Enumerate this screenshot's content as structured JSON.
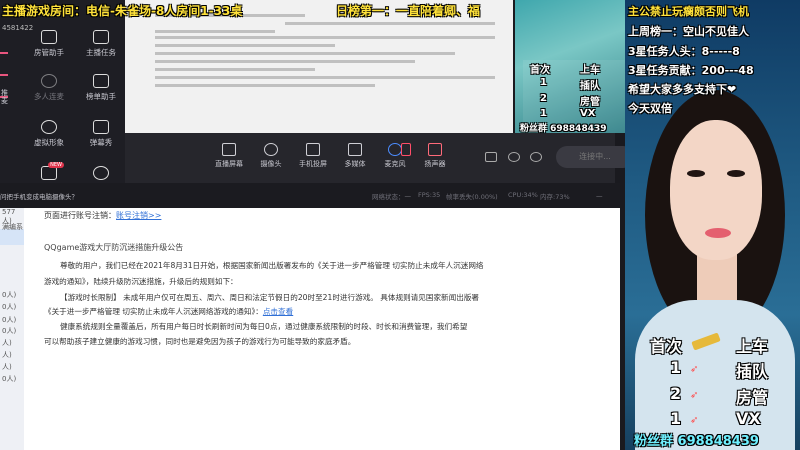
{
  "overlay": {
    "top_title": "主播游戏房间：电信-朱雀场-8人房间1-33桌",
    "daily_rank": "日榜第一：一直陪着卿、福",
    "right_lines": [
      "主公禁止玩瘸颇否则飞机",
      "上周榜一：空山不见佳人",
      "3星任务人头：8-----8",
      "3星任务贡献：200---48",
      "希望大家多多支持下❤",
      "今天双倍"
    ],
    "small_board": {
      "first": "首次",
      "first_reward": "上车",
      "rows": [
        {
          "count": "1",
          "reward": "插队"
        },
        {
          "count": "2",
          "reward": "房管"
        },
        {
          "count": "1",
          "reward": "VX"
        }
      ],
      "fans": "粉丝群 698848439"
    },
    "big_board": {
      "first": "首次",
      "first_reward": "上车",
      "rows": [
        {
          "count": "1",
          "reward": "插队"
        },
        {
          "count": "2",
          "reward": "房管"
        },
        {
          "count": "1",
          "reward": "VX"
        }
      ],
      "fans": "粉丝群 698848439"
    }
  },
  "sidebar": {
    "user_id": "4581422",
    "tiles": [
      "房管助手",
      "主播任务",
      "多人连麦",
      "榜单助手",
      "虚拟形象",
      "弹幕秀"
    ],
    "partial_left": [
      "推",
      "麦"
    ]
  },
  "toolbar": {
    "buttons": [
      "直播屏幕",
      "摄像头",
      "手机投屏",
      "多媒体",
      "麦克风",
      "扬声器"
    ],
    "go_live": "连接中..."
  },
  "statusbar": {
    "hint": "问把手机变成电脑摄像头？",
    "items": [
      "网络状态：一",
      "FPS:35",
      "帧率丢失(0.00%)",
      "CPU:34%",
      "内存:73%",
      "一"
    ]
  },
  "notice": {
    "side_items": [
      "577人)",
      "满编系",
      "0人)",
      "0人)",
      "0人)",
      "0人)",
      "人)",
      "人)",
      "人)",
      "0人)"
    ],
    "top_line_prefix": "页面进行账号注销：",
    "top_link": "账号注销>>",
    "heading": "QQgame游戏大厅防沉迷措施升级公告",
    "para1_line1": "尊敬的用户，我们已经在2021年8月31日开始，根据国家新闻出版署发布的《关于进一步严格管理 切实防止未成年人沉迷网络",
    "para1_line2": "游戏的通知》，陆续升级防沉迷措施，升级后的规则如下：",
    "para2_line1": "【游戏时长限制】 未成年用户仅可在周五、周六、周日和法定节假日的20时至21时进行游戏。 具体规则请见国家新闻出版署",
    "para2_line2": "《关于进一步严格管理 切实防止未成年人沉迷网络游戏的通知》：",
    "para2_link": "点击查看",
    "para3_line1": "健康系统规则全量覆盖后，所有用户每日时长刷新时间为每日0点，通过健康系统限制的时段、时长和消费管理，我们希望",
    "para3_line2": "可以帮助孩子建立健康的游戏习惯，同时也是避免因为孩子的游戏行为可能导致的家庭矛盾。"
  },
  "colors": {
    "overlay_yellow": "#ffe23a",
    "overlay_cyan": "#6ff0ff",
    "link_blue": "#2f6fd6",
    "toolbar_bg": "#26262c"
  }
}
